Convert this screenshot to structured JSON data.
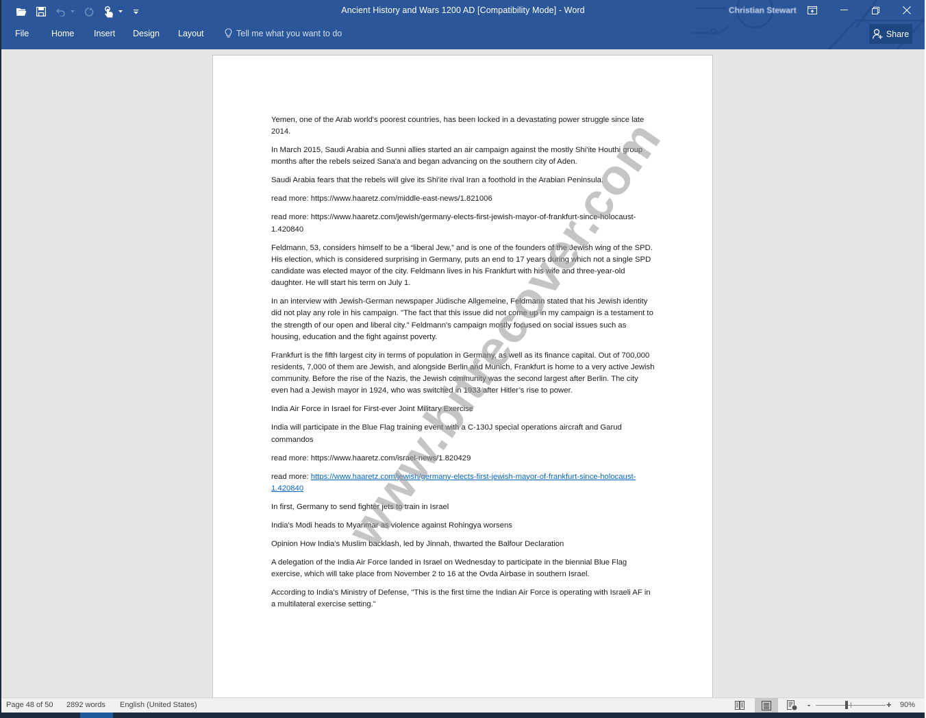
{
  "app": {
    "window_title": "Ancient History and Wars 1200 AD [Compatibility Mode]  -  Word",
    "user_name": "Christian Stewart",
    "accent_color": "#2b579a"
  },
  "quick_access": {
    "open_icon": "folder-open-icon",
    "save_icon": "save-icon",
    "undo_icon": "undo-icon",
    "redo_icon": "redo-icon",
    "touch_mode_icon": "touch-mode-icon",
    "customize_icon": "customize-qat-icon"
  },
  "window_controls": {
    "ribbon_display": "ribbon-display-options-icon",
    "minimize": "minimize-icon",
    "restore": "restore-icon",
    "close": "close-icon"
  },
  "ribbon": {
    "tabs": [
      {
        "label": "File"
      },
      {
        "label": "Home"
      },
      {
        "label": "Insert"
      },
      {
        "label": "Design"
      },
      {
        "label": "Layout"
      }
    ],
    "tell_me_placeholder": "Tell me what you want to do",
    "share_label": "Share"
  },
  "document": {
    "paragraphs": [
      {
        "text": "Yemen, one of the Arab world's poorest countries, has been locked in a devastating power struggle since late 2014."
      },
      {
        "text": "In March 2015, Saudi Arabia and Sunni allies started an air campaign against the mostly Shi'ite Houthi group months after the rebels seized Sana'a and began advancing on the southern city of Aden."
      },
      {
        "text": "Saudi Arabia fears that the rebels will give its Shi'ite rival Iran a foothold in the Arabian Peninsula."
      },
      {
        "text": "read more: https://www.haaretz.com/middle-east-news/1.821006"
      },
      {
        "text": "read more: https://www.haaretz.com/jewish/germany-elects-first-jewish-mayor-of-frankfurt-since-holocaust-1.420840"
      },
      {
        "text": "Feldmann, 53, considers himself to be a “liberal Jew,” and is one of the founders of the Jewish wing of the SPD. His election, which is considered surprising in Germany, puts an end to 17 years during which not a single SPD candidate was elected mayor of the city. Feldmann lives in his Frankfurt with his wife and three-year-old daughter. He will start his term on July 1."
      },
      {
        "text": "In an interview with Jewish-German newspaper Jüdische Allgemeine, Feldmann stated that his Jewish identity did not play any role in his campaign. \"The fact that this issue did not come up in my campaign is a testament to the strength of our open and liberal city.\" Feldmann's campaign mostly focused on social issues such as housing, education and the fight against poverty."
      },
      {
        "text": "Frankfurt is the fifth largest city in terms of population in Germany, as well as its finance capital. Out of 700,000 residents, 7,000 of them are Jewish, and alongside Berlin and Munich, Frankfurt is home to a very active Jewish community. Before the rise of the Nazis, the Jewish community was the second largest after Berlin. The city even had a Jewish mayor in 1924, who was switched in 1933 after Hitler’s rise to power."
      },
      {
        "text": "India Air Force in Israel for First-ever Joint Military Exercise"
      },
      {
        "text": "India will participate in the Blue Flag training event with a C-130J special operations aircraft and Garud commandos"
      },
      {
        "text": "read more: https://www.haaretz.com/israel-news/1.820429"
      }
    ],
    "link_paragraph": {
      "prefix": "read more: ",
      "link_text": "https://www.haaretz.com/jewish/germany-elects-first-jewish-mayor-of-frankfurt-since-holocaust-1.420840"
    },
    "paragraphs_after": [
      {
        "text": "In first, Germany to send fighter jets to train in Israel"
      },
      {
        "text": "India's Modi heads to Myanmar as violence against Rohingya worsens"
      },
      {
        "text": "Opinion How India's Muslim backlash, led by Jinnah, thwarted the Balfour Declaration"
      },
      {
        "text": "A delegation of the India Air Force landed in Israel on Wednesday to participate in the biennial Blue Flag exercise, which will take place from November 2 to 16 at the Ovda Airbase in southern Israel."
      },
      {
        "text": "According to India's Ministry of Defense, \"This is the first time the Indian Air Force is operating with Israeli AF in a multilateral exercise setting.\""
      }
    ],
    "link_color": "#0563c1",
    "watermark": "www.bitrecover.com"
  },
  "status_bar": {
    "page_info": "Page 48 of 50",
    "word_count": "2892 words",
    "language": "English (United States)",
    "views": [
      {
        "name": "read-mode",
        "active": false
      },
      {
        "name": "print-layout",
        "active": true
      },
      {
        "name": "web-layout",
        "active": false
      }
    ],
    "zoom_minus": "-",
    "zoom_plus": "+",
    "zoom_level": "90%",
    "zoom_value_percent": 90
  }
}
